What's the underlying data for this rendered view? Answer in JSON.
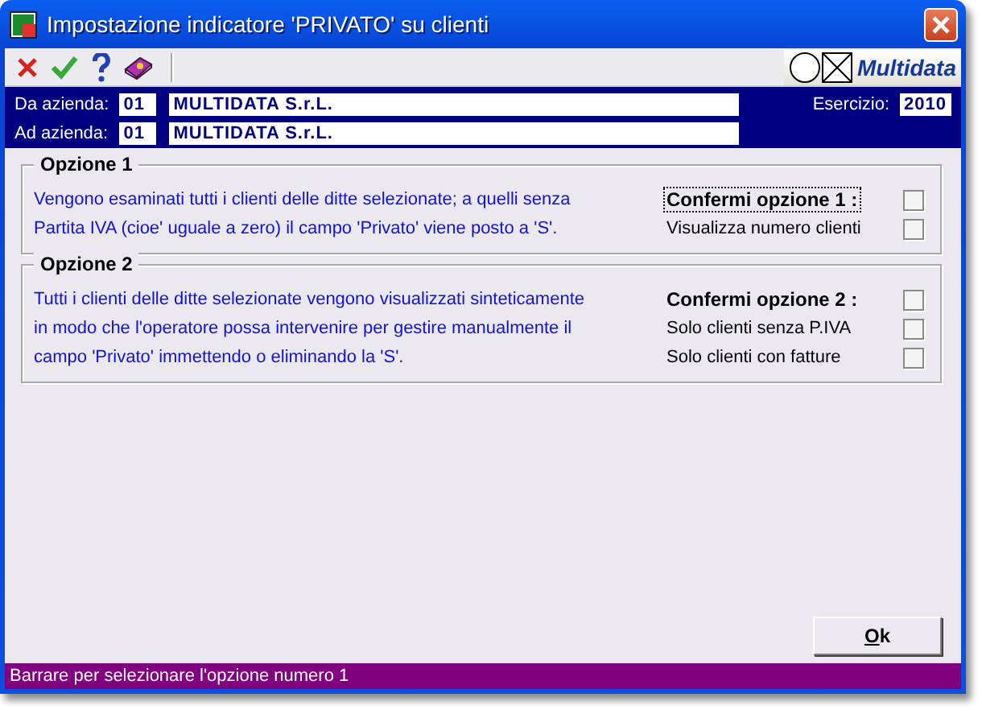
{
  "window": {
    "title": "Impostazione indicatore 'PRIVATO' su clienti"
  },
  "toolbar": {
    "logo": "Multidata"
  },
  "header": {
    "rows": [
      {
        "label": "Da azienda:",
        "code": "01",
        "name": "MULTIDATA S.r.L."
      },
      {
        "label": "Ad azienda:",
        "code": "01",
        "name": "MULTIDATA S.r.L."
      }
    ],
    "year_label": "Esercizio:",
    "year": "2010"
  },
  "options": [
    {
      "title": "Opzione 1",
      "description": [
        "Vengono esaminati tutti i clienti delle ditte selezionate; a quelli senza",
        "Partita IVA (cioe' uguale a zero) il campo 'Privato' viene posto a 'S'."
      ],
      "checks": [
        {
          "kind": "confirm",
          "label": "Confermi opzione 1 :",
          "checked": false,
          "focused": true
        },
        {
          "kind": "option",
          "label": "Visualizza numero clienti",
          "checked": false,
          "focused": false
        }
      ]
    },
    {
      "title": "Opzione 2",
      "description": [
        "Tutti i clienti delle ditte selezionate vengono visualizzati sinteticamente",
        "in modo che l'operatore possa intervenire per gestire manualmente il",
        "campo 'Privato' immettendo o eliminando la 'S'."
      ],
      "checks": [
        {
          "kind": "confirm",
          "label": "Confermi opzione 2 :",
          "checked": false,
          "focused": false
        },
        {
          "kind": "option",
          "label": "Solo clienti senza P.IVA",
          "checked": false,
          "focused": false
        },
        {
          "kind": "option",
          "label": "Solo clienti con fatture",
          "checked": false,
          "focused": false
        }
      ]
    }
  ],
  "ok_button": {
    "underlined": "O",
    "rest": "k"
  },
  "status_bar": "Barrare per selezionare l'opzione numero 1"
}
